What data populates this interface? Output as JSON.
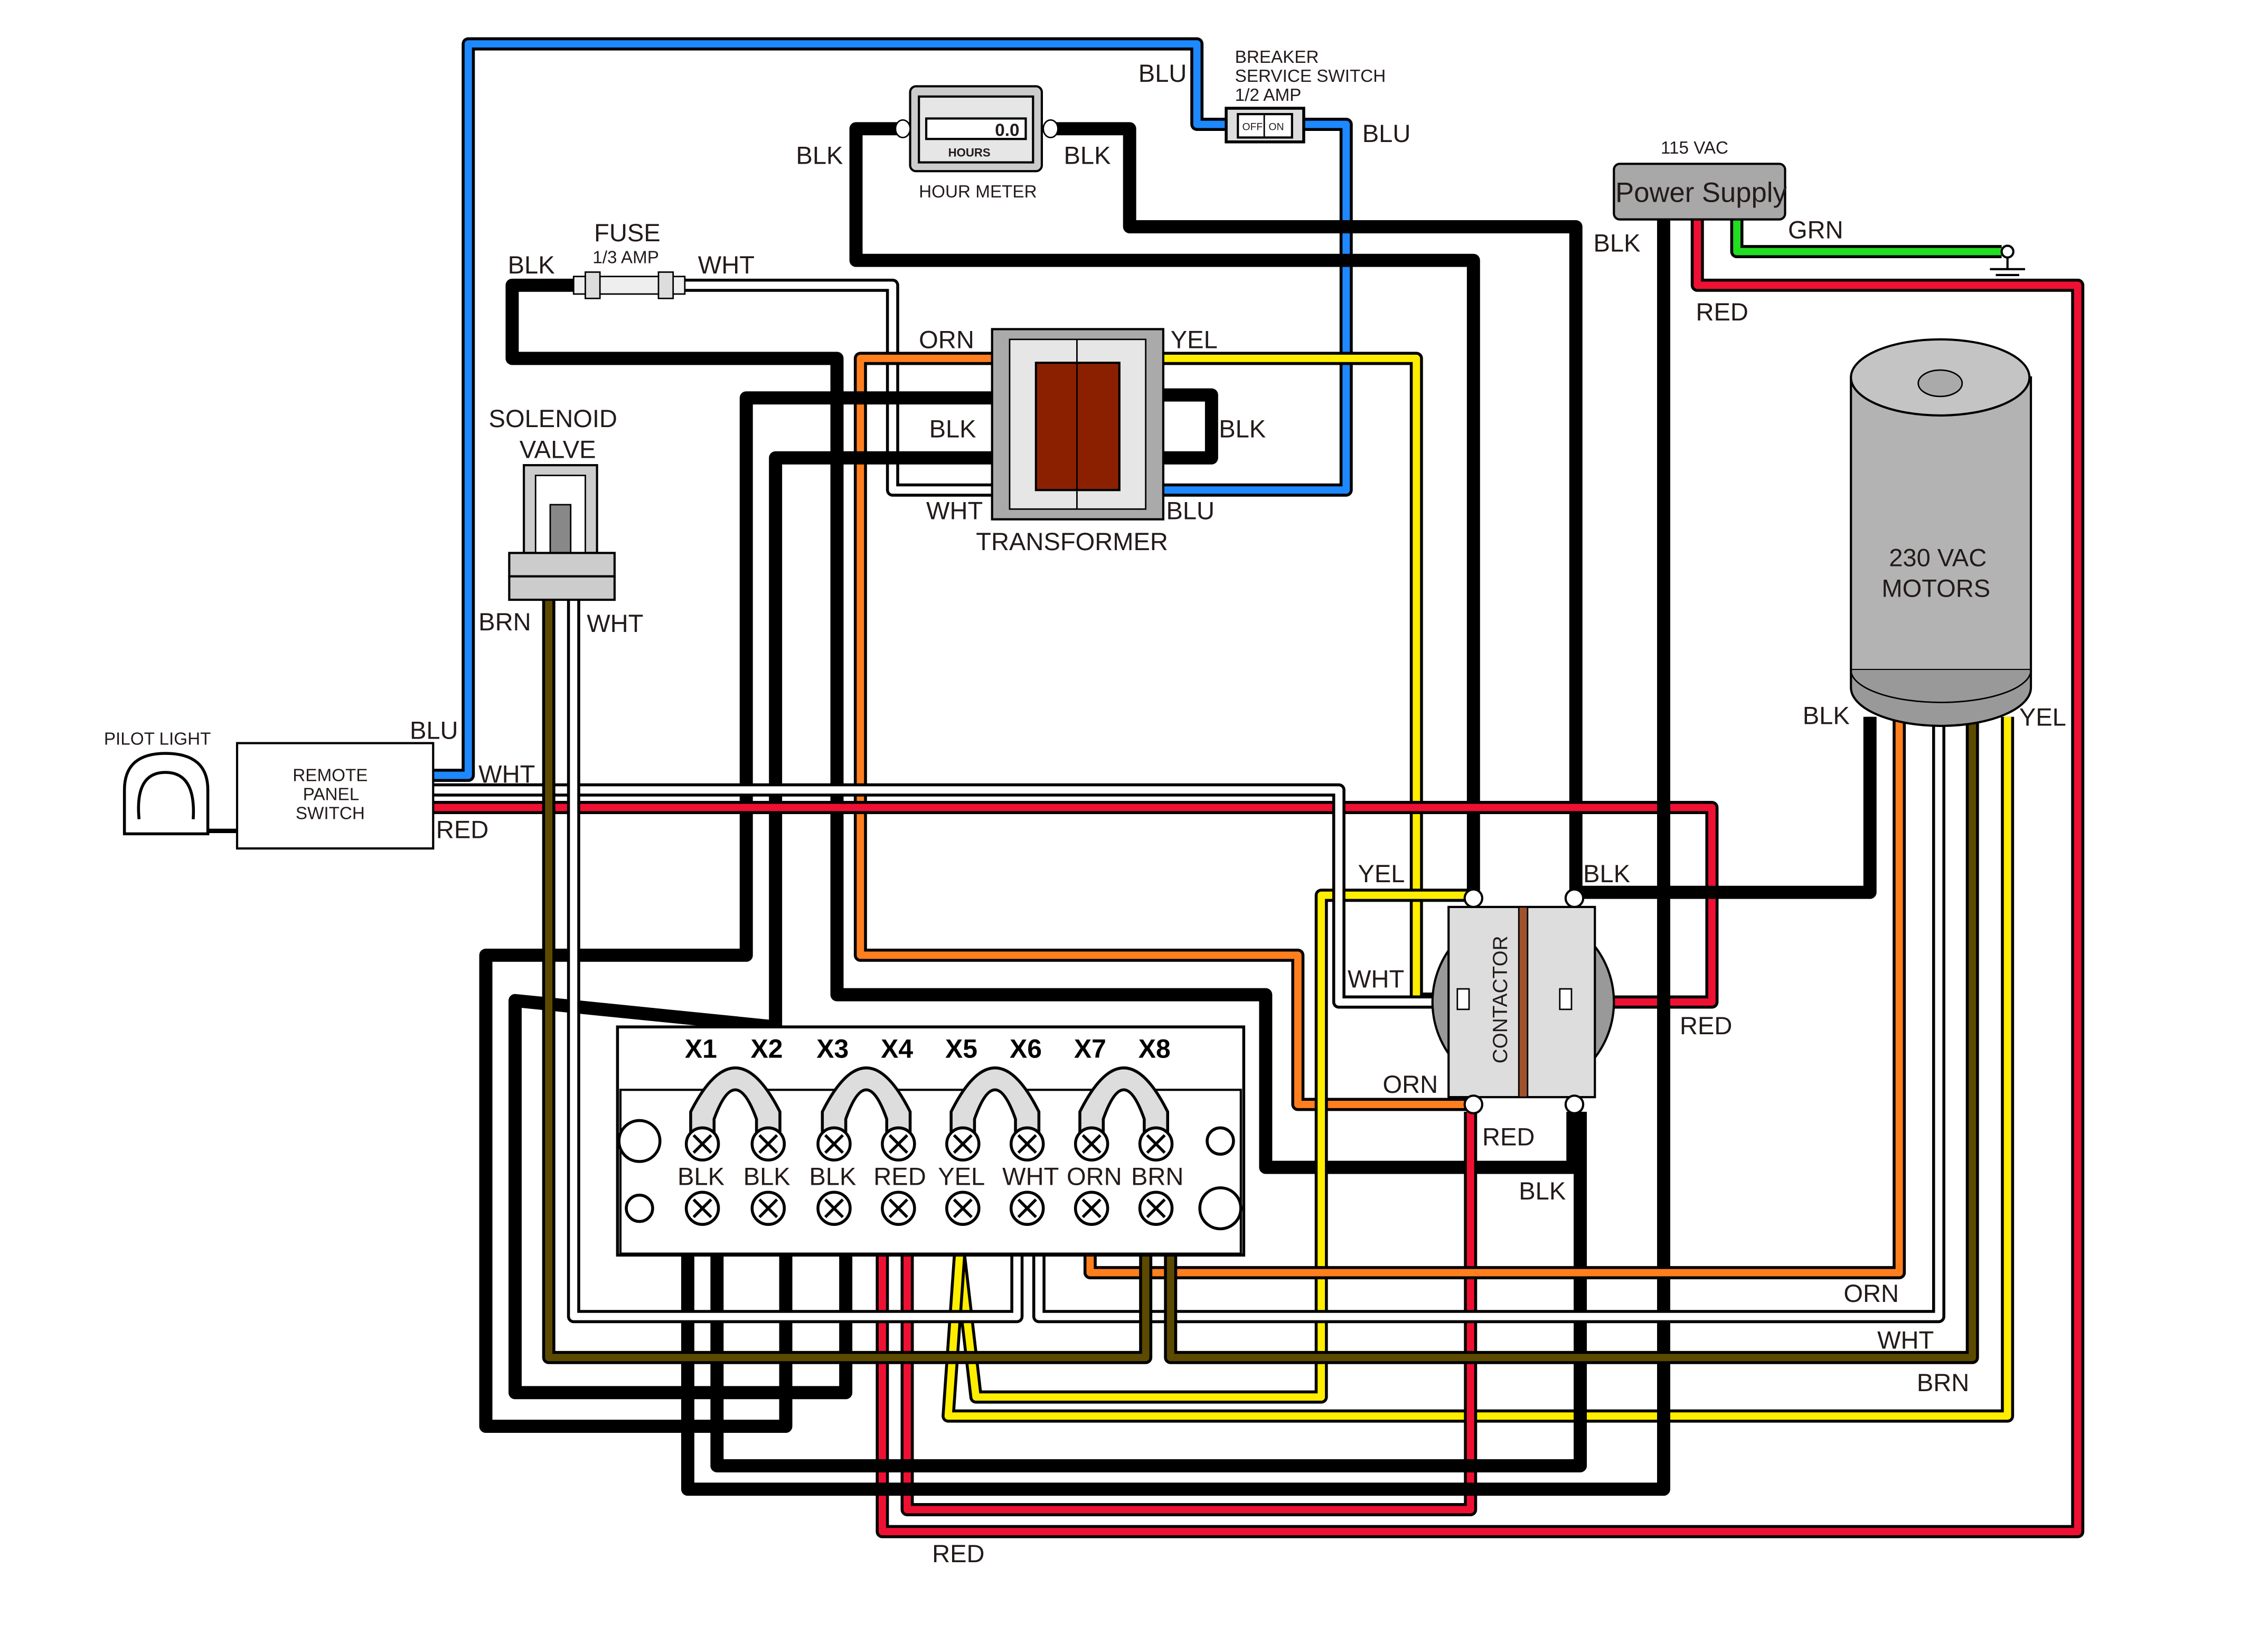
{
  "wire_colors": {
    "BLK": "#000000",
    "BLU": "#1e88ff",
    "WHT": "#ffffff",
    "ORN": "#ff7f1f",
    "YEL": "#ffee00",
    "RED": "#ee1133",
    "GRN": "#22dd22",
    "BRN": "#5c4a00"
  },
  "components": {
    "breaker": {
      "title1": "BREAKER",
      "title2": "SERVICE SWITCH",
      "title3": "1/2 AMP",
      "off": "OFF",
      "on": "ON"
    },
    "hour_meter": {
      "title": "HOUR METER",
      "display": "0.0",
      "unit": "HOURS"
    },
    "fuse": {
      "title": "FUSE",
      "rating": "1/3 AMP"
    },
    "power_supply": {
      "voltage": "115 VAC",
      "title": "Power Supply"
    },
    "transformer": {
      "title": "TRANSFORMER"
    },
    "solenoid": {
      "title1": "SOLENOID",
      "title2": "VALVE"
    },
    "motors": {
      "title1": "230 VAC",
      "title2": "MOTORS"
    },
    "pilot_light": {
      "title": "PILOT LIGHT"
    },
    "remote_switch": {
      "title1": "REMOTE",
      "title2": "PANEL",
      "title3": "SWITCH"
    },
    "contactor": {
      "title": "CONTACTOR"
    },
    "terminal_block": {
      "terminals": [
        "X1",
        "X2",
        "X3",
        "X4",
        "X5",
        "X6",
        "X7",
        "X8"
      ],
      "wire_labels": [
        "BLK",
        "BLK",
        "BLK",
        "RED",
        "YEL",
        "WHT",
        "ORN",
        "BRN"
      ]
    }
  },
  "wire_labels": {
    "blu_top": "BLU",
    "blu_breaker": "BLU",
    "blk_hm_left": "BLK",
    "blk_hm_right": "BLK",
    "blk_fuse": "BLK",
    "wht_fuse": "WHT",
    "blk_ps": "BLK",
    "grn_ps": "GRN",
    "red_ps": "RED",
    "orn_tr": "ORN",
    "yel_tr": "YEL",
    "blk_tr_left": "BLK",
    "blk_tr_right": "BLK",
    "wht_tr": "WHT",
    "blu_tr": "BLU",
    "brn_sol": "BRN",
    "wht_sol": "WHT",
    "blu_remote": "BLU",
    "wht_remote": "WHT",
    "red_remote": "RED",
    "blk_motor": "BLK",
    "yel_motor": "YEL",
    "yel_cont": "YEL",
    "blk_cont": "BLK",
    "wht_cont": "WHT",
    "red_cont_right": "RED",
    "orn_cont": "ORN",
    "red_cont_bottom": "RED",
    "blk_cont_bottom": "BLK",
    "orn_bottom": "ORN",
    "wht_bottom": "WHT",
    "brn_bottom": "BRN",
    "red_bottom": "RED"
  }
}
